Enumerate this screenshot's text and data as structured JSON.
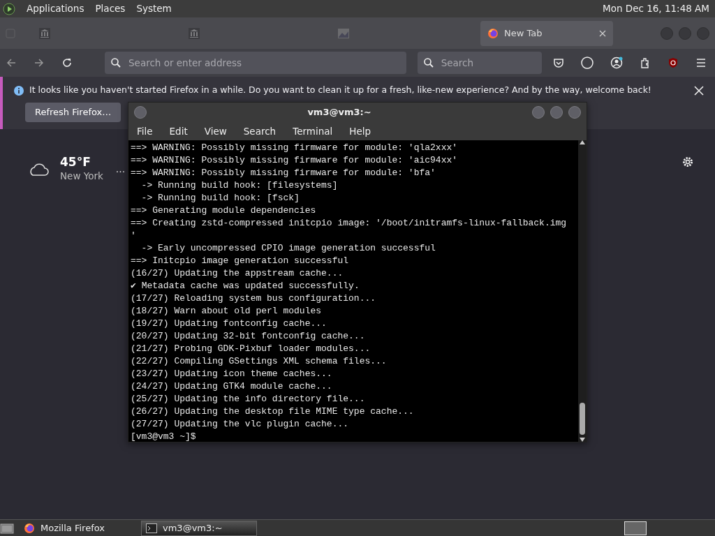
{
  "top_panel": {
    "menus": [
      "Applications",
      "Places",
      "System"
    ],
    "clock": "Mon Dec 16, 11:48 AM"
  },
  "browser": {
    "tabs": [
      {
        "kind": "page",
        "selected": false
      },
      {
        "kind": "page",
        "selected": false
      },
      {
        "kind": "image",
        "selected": false
      },
      {
        "kind": "firefox",
        "label": "New Tab",
        "selected": true
      }
    ],
    "address_placeholder": "Search or enter address",
    "search_placeholder": "Search",
    "notification": {
      "text": "It looks like you haven't started Firefox in a while. Do you want to clean it up for a fresh, like-new experience? And by the way, welcome back!",
      "button": "Refresh Firefox…"
    },
    "weather": {
      "temperature": "45°F",
      "location": "New York",
      "menu": "..."
    }
  },
  "terminal": {
    "title": "vm3@vm3:~",
    "menus": [
      "File",
      "Edit",
      "View",
      "Search",
      "Terminal",
      "Help"
    ],
    "lines": [
      "==> WARNING: Possibly missing firmware for module: 'qla2xxx'",
      "==> WARNING: Possibly missing firmware for module: 'aic94xx'",
      "==> WARNING: Possibly missing firmware for module: 'bfa'",
      "  -> Running build hook: [filesystems]",
      "  -> Running build hook: [fsck]",
      "==> Generating module dependencies",
      "==> Creating zstd-compressed initcpio image: '/boot/initramfs-linux-fallback.img",
      "'",
      "  -> Early uncompressed CPIO image generation successful",
      "==> Initcpio image generation successful",
      "(16/27) Updating the appstream cache...",
      "✔ Metadata cache was updated successfully.",
      "(17/27) Reloading system bus configuration...",
      "(18/27) Warn about old perl modules",
      "(19/27) Updating fontconfig cache...",
      "(20/27) Updating 32-bit fontconfig cache...",
      "(21/27) Probing GDK-Pixbuf loader modules...",
      "(22/27) Compiling GSettings XML schema files...",
      "(23/27) Updating icon theme caches...",
      "(24/27) Updating GTK4 module cache...",
      "(25/27) Updating the info directory file...",
      "(26/27) Updating the desktop file MIME type cache...",
      "(27/27) Updating the vlc plugin cache...",
      "[vm3@vm3 ~]$"
    ]
  },
  "taskbar": {
    "items": [
      {
        "kind": "firefox",
        "label": "Mozilla Firefox",
        "selected": false
      },
      {
        "kind": "terminal",
        "label": "vm3@vm3:~",
        "selected": true
      }
    ]
  }
}
